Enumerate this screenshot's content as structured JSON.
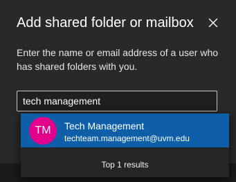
{
  "dialog": {
    "title": "Add shared folder or mailbox",
    "close_icon": "close-icon",
    "description": "Enter the name or email address of a user who has shared folders with you."
  },
  "search": {
    "value": "tech management"
  },
  "suggestions": {
    "items": [
      {
        "initials": "TM",
        "name": "Tech Management",
        "email": "techteam.management@uvm.edu"
      }
    ],
    "results_text": "Top 1 results"
  },
  "colors": {
    "dialog_background": "#292929",
    "selected_item": "#0f5fa8",
    "avatar": "#e3008c"
  }
}
